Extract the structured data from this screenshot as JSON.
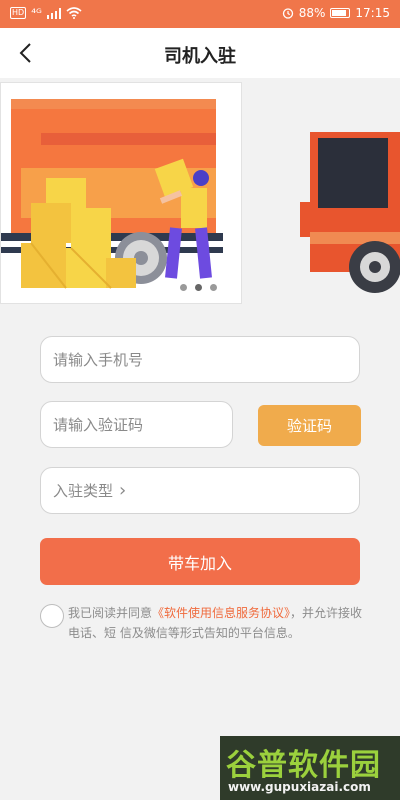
{
  "status_bar": {
    "hd": "HD",
    "signal": "⁴ᴳ",
    "battery": "88%",
    "time": "17:15"
  },
  "nav": {
    "title": "司机入驻"
  },
  "banner": {
    "dots_total": 3,
    "dot_active_index": 1
  },
  "form": {
    "phone_placeholder": "请输入手机号",
    "code_placeholder": "请输入验证码",
    "code_button": "验证码",
    "type_label": "入驻类型",
    "type_chevron": "›",
    "submit_label": "带车加入"
  },
  "agreement": {
    "prefix": "我已阅读并同意",
    "link": "《软件使用信息服务协议》",
    "suffix": "，并允许接收电话、短 信及微信等形式告知的平台信息。"
  },
  "watermark": {
    "title": "谷普软件园",
    "url": "www.gupuxiazai.com"
  },
  "colors": {
    "status_bar": "#f0764a",
    "code_button": "#f0ab4c",
    "submit_button": "#f26e4a",
    "link": "#f06a3c"
  }
}
